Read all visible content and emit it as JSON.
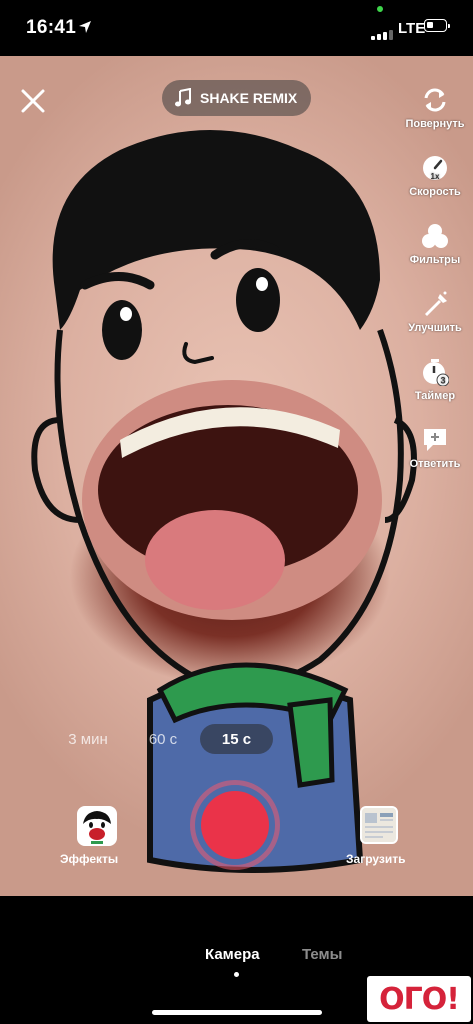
{
  "status_bar": {
    "time": "16:41",
    "network": "LTE"
  },
  "sound": {
    "label": "SHAKE REMIX"
  },
  "side_tools": [
    {
      "label": "Повернуть",
      "icon": "flip-camera-icon"
    },
    {
      "label": "Скорость",
      "icon": "speed-icon",
      "badge": "1x"
    },
    {
      "label": "Фильтры",
      "icon": "filters-icon"
    },
    {
      "label": "Улучшить",
      "icon": "beautify-icon"
    },
    {
      "label": "Таймер",
      "icon": "timer-icon",
      "badge": "3"
    },
    {
      "label": "Ответить",
      "icon": "reply-icon"
    }
  ],
  "durations": {
    "d1": "3 мин",
    "d2": "60 с",
    "d3": "15 с",
    "selected": "15 с"
  },
  "effects": {
    "label": "Эффекты"
  },
  "upload": {
    "label": "Загрузить"
  },
  "tabs": {
    "camera": "Камера",
    "themes": "Темы",
    "active": "Камера"
  },
  "watermark": {
    "text": "ОГО!"
  },
  "colors": {
    "record": "#ea3349",
    "background": "#000000"
  }
}
